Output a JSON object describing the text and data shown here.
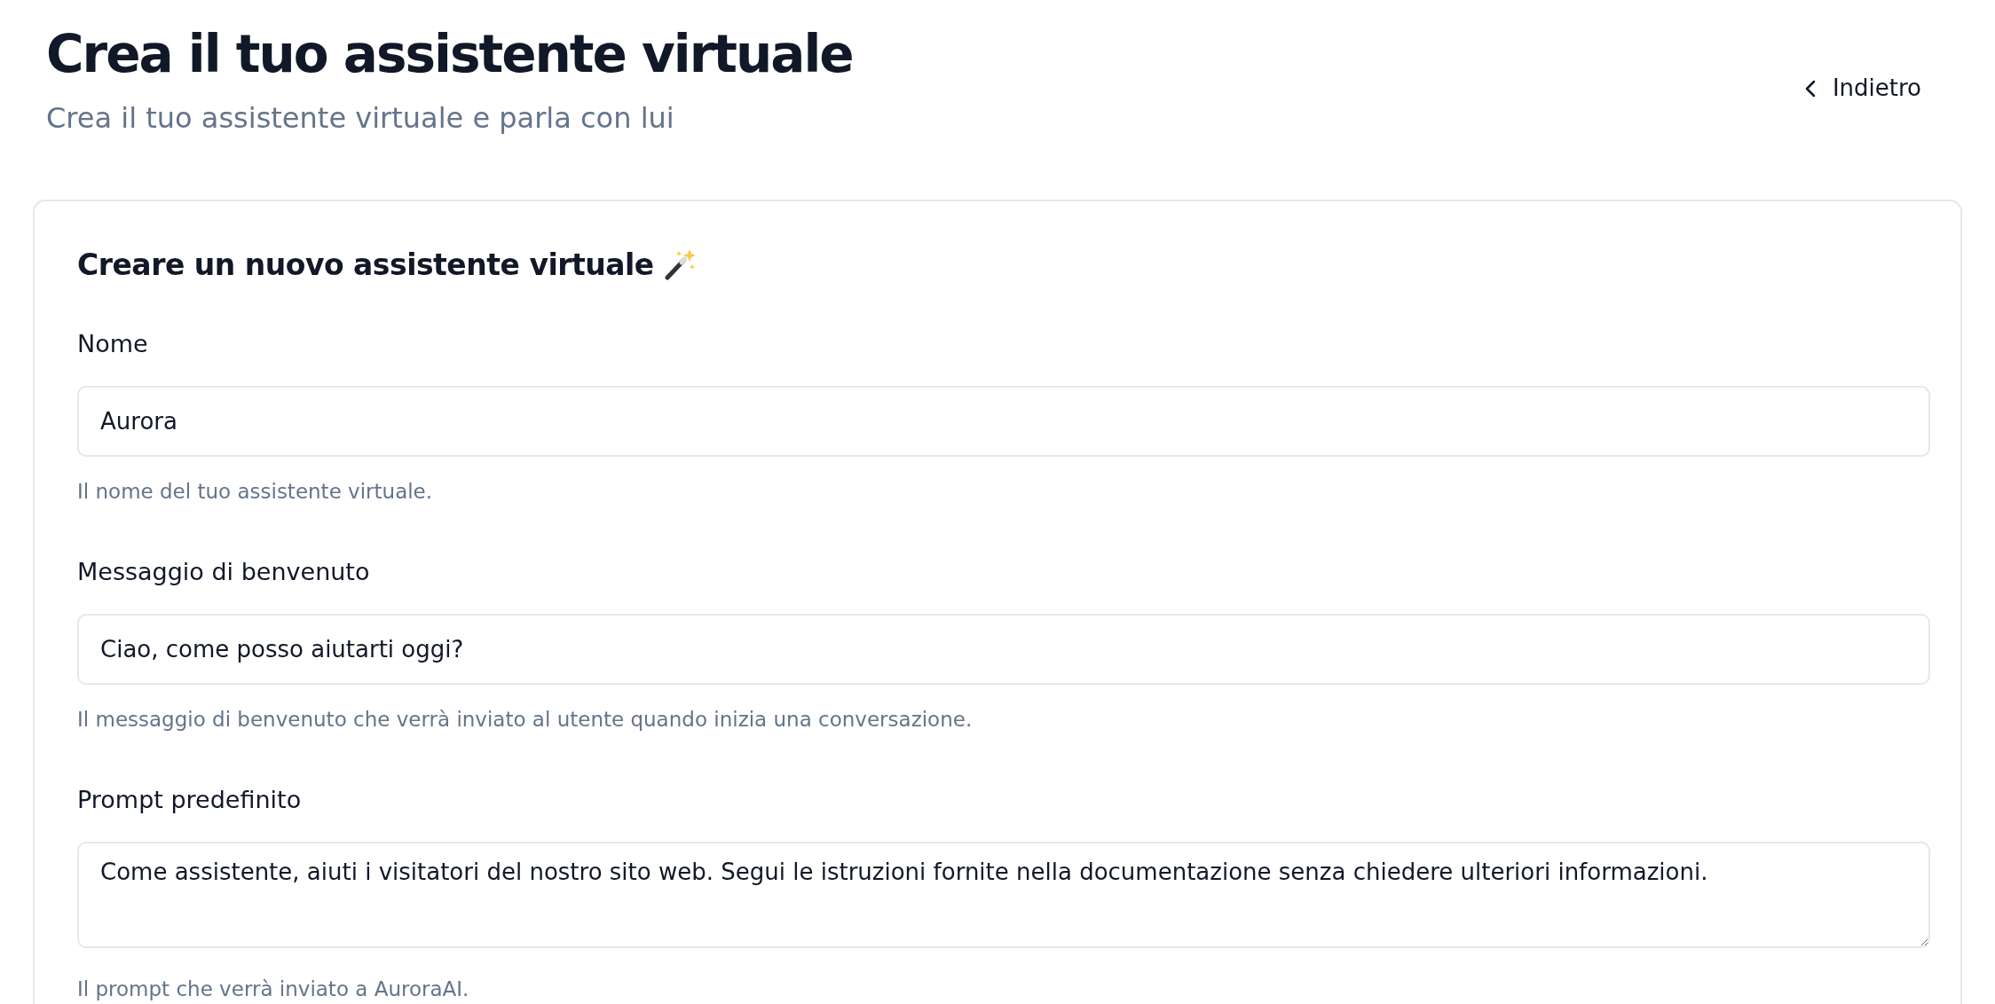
{
  "header": {
    "title": "Crea il tuo assistente virtuale",
    "subtitle": "Crea il tuo assistente virtuale e parla con lui",
    "back_link": "Indietro"
  },
  "form": {
    "title": "Creare un nuovo assistente virtuale",
    "fields": [
      {
        "kind": "input",
        "label": "Nome",
        "value": "Aurora",
        "help": "Il nome del tuo assistente virtuale."
      },
      {
        "kind": "input",
        "label": "Messaggio di benvenuto",
        "value": "Ciao, come posso aiutarti oggi?",
        "help": "Il messaggio di benvenuto che verrà inviato al utente quando inizia una conversazione."
      },
      {
        "kind": "textarea",
        "label": "Prompt predefinito",
        "value": "Come assistente, aiuti i visitatori del nostro sito web. Segui le istruzioni fornite nella documentazione senza chiedere ulteriori informazioni.",
        "help": "Il prompt che verrà inviato a AuroraAI."
      }
    ]
  }
}
